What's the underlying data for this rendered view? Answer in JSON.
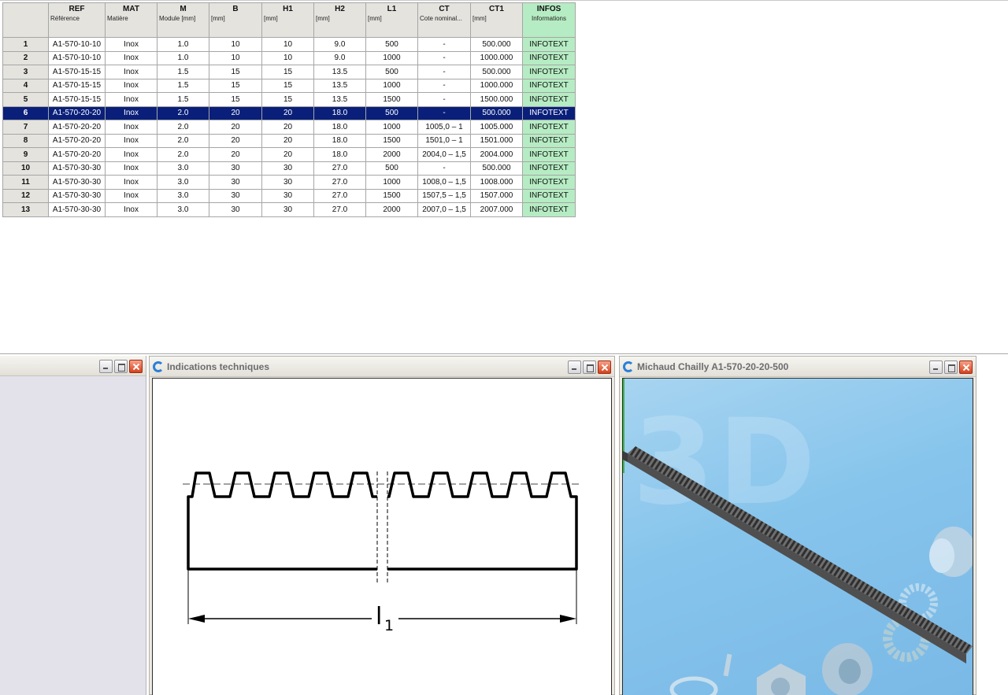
{
  "table": {
    "columns": [
      {
        "code": "REF",
        "desc": "Référence"
      },
      {
        "code": "MAT",
        "desc": "Matière"
      },
      {
        "code": "M",
        "desc": "Module [mm]"
      },
      {
        "code": "B",
        "desc": "[mm]"
      },
      {
        "code": "H1",
        "desc": "[mm]"
      },
      {
        "code": "H2",
        "desc": "[mm]"
      },
      {
        "code": "L1",
        "desc": "[mm]"
      },
      {
        "code": "CT",
        "desc": "Cote nominal..."
      },
      {
        "code": "CT1",
        "desc": "[mm]"
      },
      {
        "code": "INFOS",
        "desc": "Informations"
      }
    ],
    "selected_row": 6,
    "rows": [
      {
        "n": "1",
        "ref": "A1-570-10-10",
        "mat": "Inox",
        "m": "1.0",
        "b": "10",
        "h1": "10",
        "h2": "9.0",
        "l1": "500",
        "ct": "-",
        "ct1": "500.000",
        "infos": "INFOTEXT"
      },
      {
        "n": "2",
        "ref": "A1-570-10-10",
        "mat": "Inox",
        "m": "1.0",
        "b": "10",
        "h1": "10",
        "h2": "9.0",
        "l1": "1000",
        "ct": "-",
        "ct1": "1000.000",
        "infos": "INFOTEXT"
      },
      {
        "n": "3",
        "ref": "A1-570-15-15",
        "mat": "Inox",
        "m": "1.5",
        "b": "15",
        "h1": "15",
        "h2": "13.5",
        "l1": "500",
        "ct": "-",
        "ct1": "500.000",
        "infos": "INFOTEXT"
      },
      {
        "n": "4",
        "ref": "A1-570-15-15",
        "mat": "Inox",
        "m": "1.5",
        "b": "15",
        "h1": "15",
        "h2": "13.5",
        "l1": "1000",
        "ct": "-",
        "ct1": "1000.000",
        "infos": "INFOTEXT"
      },
      {
        "n": "5",
        "ref": "A1-570-15-15",
        "mat": "Inox",
        "m": "1.5",
        "b": "15",
        "h1": "15",
        "h2": "13.5",
        "l1": "1500",
        "ct": "-",
        "ct1": "1500.000",
        "infos": "INFOTEXT"
      },
      {
        "n": "6",
        "ref": "A1-570-20-20",
        "mat": "Inox",
        "m": "2.0",
        "b": "20",
        "h1": "20",
        "h2": "18.0",
        "l1": "500",
        "ct": "-",
        "ct1": "500.000",
        "infos": "INFOTEXT"
      },
      {
        "n": "7",
        "ref": "A1-570-20-20",
        "mat": "Inox",
        "m": "2.0",
        "b": "20",
        "h1": "20",
        "h2": "18.0",
        "l1": "1000",
        "ct": "1005,0 – 1",
        "ct1": "1005.000",
        "infos": "INFOTEXT"
      },
      {
        "n": "8",
        "ref": "A1-570-20-20",
        "mat": "Inox",
        "m": "2.0",
        "b": "20",
        "h1": "20",
        "h2": "18.0",
        "l1": "1500",
        "ct": "1501,0 – 1",
        "ct1": "1501.000",
        "infos": "INFOTEXT"
      },
      {
        "n": "9",
        "ref": "A1-570-20-20",
        "mat": "Inox",
        "m": "2.0",
        "b": "20",
        "h1": "20",
        "h2": "18.0",
        "l1": "2000",
        "ct": "2004,0 – 1,5",
        "ct1": "2004.000",
        "infos": "INFOTEXT"
      },
      {
        "n": "10",
        "ref": "A1-570-30-30",
        "mat": "Inox",
        "m": "3.0",
        "b": "30",
        "h1": "30",
        "h2": "27.0",
        "l1": "500",
        "ct": "-",
        "ct1": "500.000",
        "infos": "INFOTEXT"
      },
      {
        "n": "11",
        "ref": "A1-570-30-30",
        "mat": "Inox",
        "m": "3.0",
        "b": "30",
        "h1": "30",
        "h2": "27.0",
        "l1": "1000",
        "ct": "1008,0 – 1,5",
        "ct1": "1008.000",
        "infos": "INFOTEXT"
      },
      {
        "n": "12",
        "ref": "A1-570-30-30",
        "mat": "Inox",
        "m": "3.0",
        "b": "30",
        "h1": "30",
        "h2": "27.0",
        "l1": "1500",
        "ct": "1507,5 – 1,5",
        "ct1": "1507.000",
        "infos": "INFOTEXT"
      },
      {
        "n": "13",
        "ref": "A1-570-30-30",
        "mat": "Inox",
        "m": "3.0",
        "b": "30",
        "h1": "30",
        "h2": "27.0",
        "l1": "2000",
        "ct": "2007,0 – 1,5",
        "ct1": "2007.000",
        "infos": "INFOTEXT"
      }
    ]
  },
  "windows": {
    "tech": {
      "title": "Indications techniques",
      "dimension_label": "l",
      "dimension_sub": "1"
    },
    "view3d": {
      "title": "Michaud Chailly A1-570-20-20-500",
      "badge": "3D"
    }
  },
  "colors": {
    "selection": "#0a1f7a",
    "infos_column": "#b6ecc3",
    "header": "#e4e3de",
    "viewport_sky": "#86c4ec"
  }
}
